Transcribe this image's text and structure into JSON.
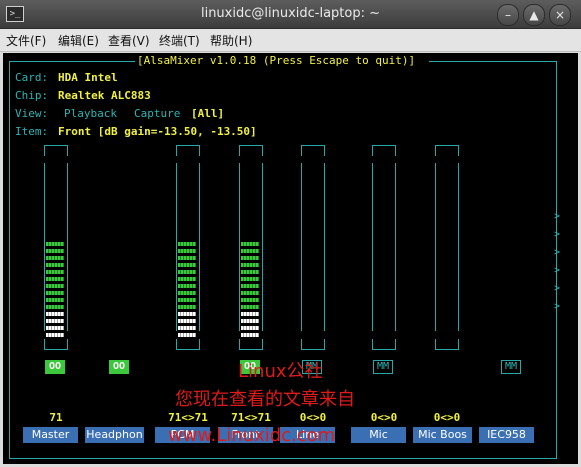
{
  "window": {
    "title": "linuxidc@linuxidc-laptop: ~",
    "icon": "terminal-icon"
  },
  "menu": [
    "文件(F)",
    "编辑(E)",
    "查看(V)",
    "终端(T)",
    "帮助(H)"
  ],
  "header": {
    "title": "AlsaMixer v1.0.18 (Press Escape to quit)"
  },
  "info": {
    "card_label": "Card:",
    "card_value": "HDA Intel",
    "chip_label": "Chip:",
    "chip_value": "Realtek ALC883",
    "view_label": "View:",
    "view_playback": "Playback",
    "view_capture": "Capture",
    "view_all": "[All]",
    "item_label": "Item:",
    "item_value": "Front [dB gain=-13.50, -13.50]"
  },
  "channels": [
    {
      "name": "Master",
      "level": 0.71,
      "has_bar": true,
      "mute": "OO",
      "mute_on": true,
      "vol_text": "71"
    },
    {
      "name": "Headphon",
      "level": 0,
      "has_bar": false,
      "mute": "OO",
      "mute_on": true,
      "vol_text": ""
    },
    {
      "name": "PCM",
      "level": 0.71,
      "has_bar": true,
      "mute": "",
      "mute_on": false,
      "vol_text": "71<>71"
    },
    {
      "name": "Front",
      "level": 0.71,
      "has_bar": true,
      "mute": "OO",
      "mute_on": true,
      "vol_text": "71<>71"
    },
    {
      "name": "Line",
      "level": 0,
      "has_bar": true,
      "mute": "MM",
      "mute_on": false,
      "vol_text": "0<>0"
    },
    {
      "name": "Mic",
      "level": 0,
      "has_bar": true,
      "mute": "MM",
      "mute_on": false,
      "vol_text": "0<>0"
    },
    {
      "name": "Mic Boos",
      "level": 0,
      "has_bar": true,
      "mute": "",
      "mute_on": false,
      "vol_text": "0<>0"
    },
    {
      "name": "IEC958",
      "level": 0,
      "has_bar": false,
      "mute": "MM",
      "mute_on": false,
      "vol_text": ""
    }
  ],
  "watermark": {
    "line1": "Linux公社",
    "line2": "您现在查看的文章来自",
    "line3": "www.Linuxidc.com"
  },
  "colors": {
    "frame": "#29a8a8",
    "label": "#2fb3b3",
    "value": "#f0f040",
    "bar_green": "#3cc83c",
    "bar_white": "#ffffff",
    "name_bg": "#3b6fb3"
  }
}
